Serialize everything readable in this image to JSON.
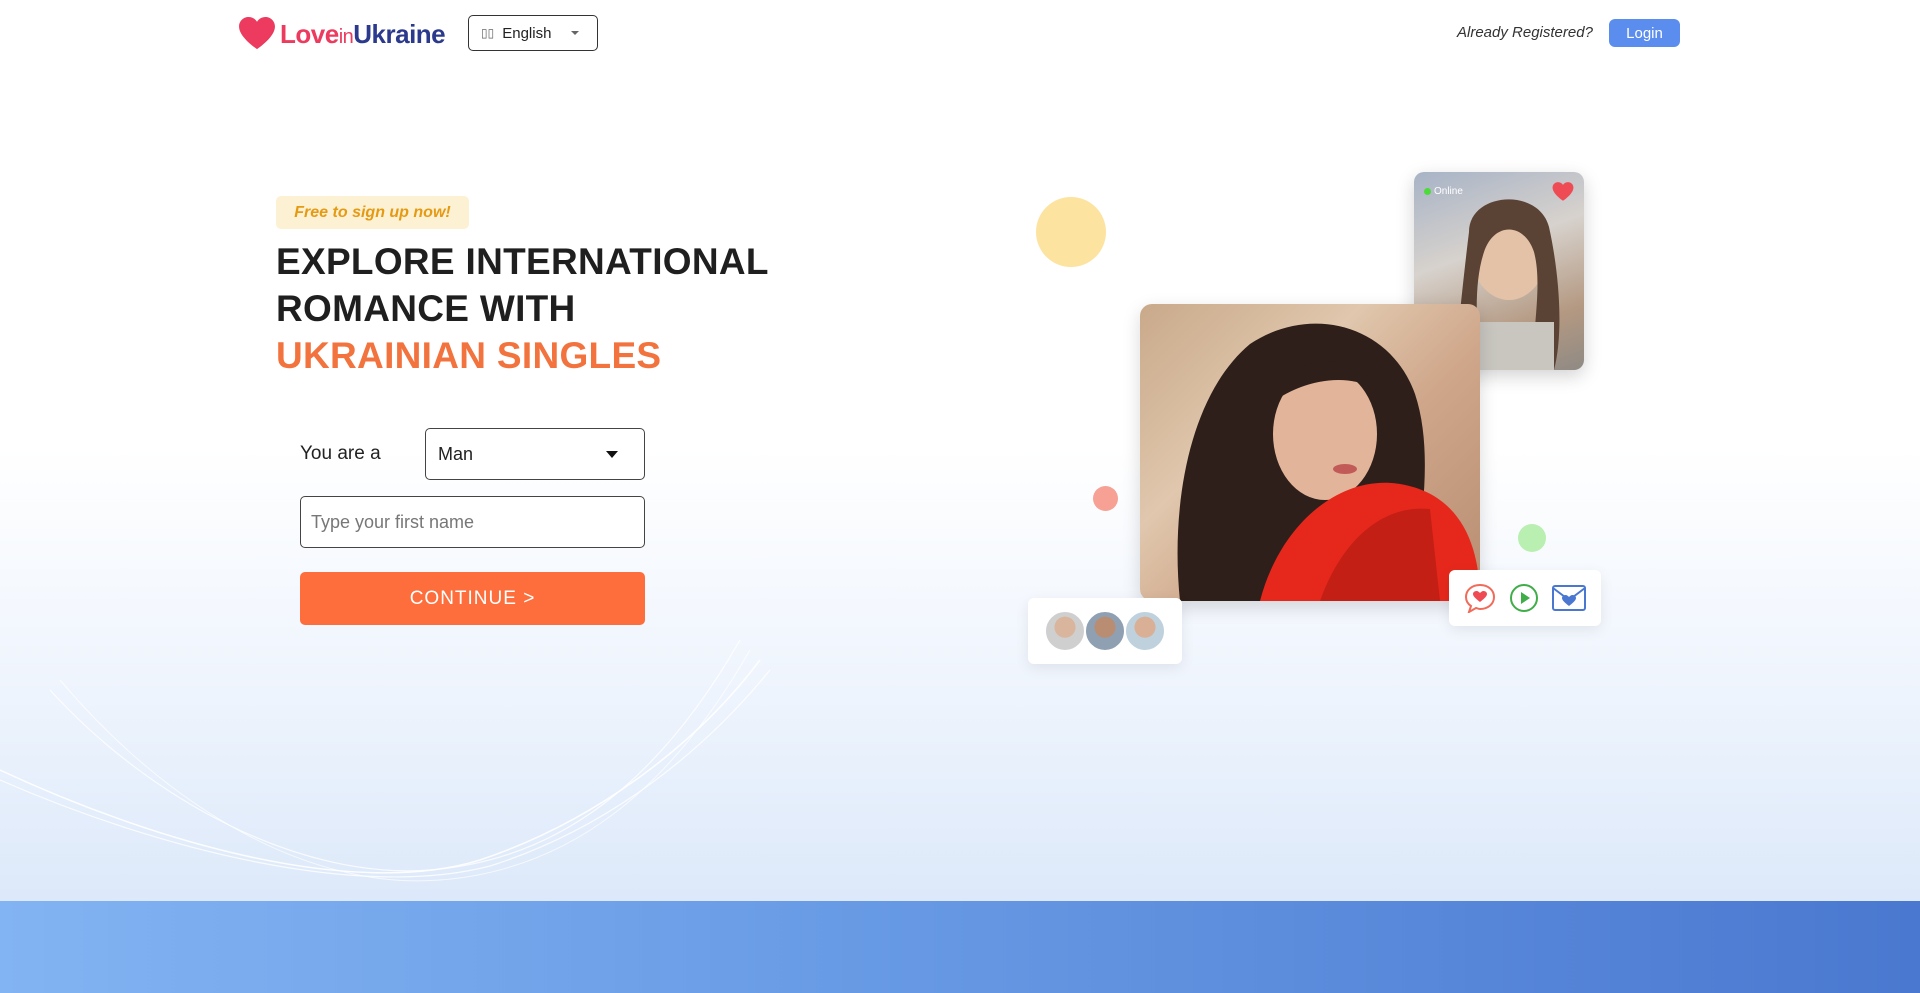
{
  "header": {
    "logo": {
      "love": "Love",
      "in": "in",
      "ukraine": "Ukraine"
    },
    "language": {
      "flag_icon": "flag-icon",
      "selected": "English"
    },
    "already_registered": "Already Registered?",
    "login_label": "Login"
  },
  "hero": {
    "badge": "Free to sign up now!",
    "headline_line1": "EXPLORE INTERNATIONAL",
    "headline_line2": "ROMANCE WITH",
    "headline_accent": "UKRAINIAN SINGLES",
    "you_are_label": "You are a",
    "gender_selected": "Man",
    "name_placeholder": "Type your first name",
    "continue_label": "CONTINUE >"
  },
  "showcase": {
    "online_label": "Online",
    "icons": [
      "chat-heart-icon",
      "play-icon",
      "mail-heart-icon"
    ]
  },
  "colors": {
    "brand_pink": "#ec3b5e",
    "brand_navy": "#2b3a8c",
    "accent_orange": "#fd6e3c",
    "login_blue": "#5b8def",
    "badge_text": "#e59a14"
  }
}
